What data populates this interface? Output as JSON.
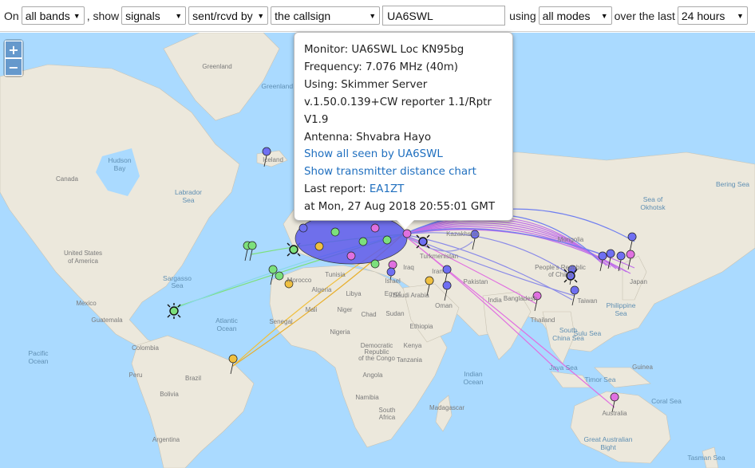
{
  "toolbar": {
    "on_label": "On",
    "bands": "all bands",
    "show_label": ", show",
    "show": "signals",
    "direction": "sent/rcvd by",
    "target": "the callsign",
    "callsign": "UA6SWL",
    "using_label": "using",
    "modes": "all modes",
    "over_label": "over the last",
    "period": "24 hours"
  },
  "zoom": {
    "in": "+",
    "out": "−"
  },
  "popup": {
    "monitor": "Monitor: UA6SWL Loc KN95bg",
    "frequency": "Frequency: 7.076 MHz (40m)",
    "using_line1": "Using: Skimmer Server",
    "using_line2": "v.1.50.0.139+CW reporter 1.1/Rptr",
    "using_line3": "V1.9",
    "antenna": "Antenna: Shvabra Hayo",
    "show_all_link": "Show all seen by UA6SWL",
    "distance_link": "Show transmitter distance chart",
    "last_report_label": "Last report:",
    "last_report_call": "EA1ZT",
    "last_report_time": "at Mon, 27 Aug 2018 20:55:01 GMT"
  },
  "map_labels": {
    "greenland": "Greenland",
    "iceland": "Iceland",
    "hudson_bay_1": "Hudson",
    "hudson_bay_2": "Bay",
    "canada": "Canada",
    "labrador_1": "Labrador",
    "labrador_2": "Sea",
    "usa_1": "United States",
    "usa_2": "of America",
    "sargasso_1": "Sargasso",
    "sargasso_2": "Sea",
    "mexico": "Mexico",
    "guatemala": "Guatemala",
    "atlantic_1": "Atlantic",
    "atlantic_2": "Ocean",
    "pacific_1": "Pacific",
    "pacific_2": "Ocean",
    "colombia": "Colombia",
    "peru": "Peru",
    "brazil": "Brazil",
    "bolivia": "Bolivia",
    "argentina": "Argentina",
    "morocco": "Morocco",
    "algeria": "Algeria",
    "libya": "Libya",
    "egypt": "Egypt",
    "mali": "Mali",
    "niger": "Niger",
    "chad": "Chad",
    "sudan": "Sudan",
    "senegal": "Senegal",
    "nigeria": "Nigeria",
    "ethiopia": "Ethiopia",
    "kenya": "Kenya",
    "tanzania": "Tanzania",
    "drc_1": "Democratic",
    "drc_2": "Republic",
    "drc_3": "of the Congo",
    "angola": "Angola",
    "namibia": "Namibia",
    "south_africa_1": "South",
    "south_africa_2": "Africa",
    "madagascar": "Madagascar",
    "indian_1": "Indian",
    "indian_2": "Ocean",
    "saudi": "Saudi Arabia",
    "iraq": "Iraq",
    "iran": "Iran",
    "oman": "Oman",
    "pakistan": "Pakistan",
    "india": "India",
    "kazakhstan": "Kazakhstan",
    "turkmenistan": "Turkmenistan",
    "tunisia": "Tunisia",
    "israel": "Israel",
    "china_1": "People's Republic",
    "china_2": "of China",
    "mongolia": "Mongolia",
    "bangladesh": "Bangladesh",
    "thailand": "Thailand",
    "taiwan": "Taiwan",
    "philippine_1": "Philippine",
    "philippine_2": "Sea",
    "south_china_1": "South",
    "south_china_2": "China Sea",
    "sulu": "Sulu Sea",
    "java": "Java Sea",
    "guinea": "Guinea",
    "timor": "Timor Sea",
    "coral": "Coral Sea",
    "australia": "Australia",
    "gab_1": "Great Australian",
    "gab_2": "Bight",
    "tasman": "Tasman Sea",
    "okhotsk_1": "Sea of",
    "okhotsk_2": "Okhotsk",
    "bering": "Bering Sea",
    "greenland_sea": "Greenland Sea",
    "japan": "Japan"
  }
}
